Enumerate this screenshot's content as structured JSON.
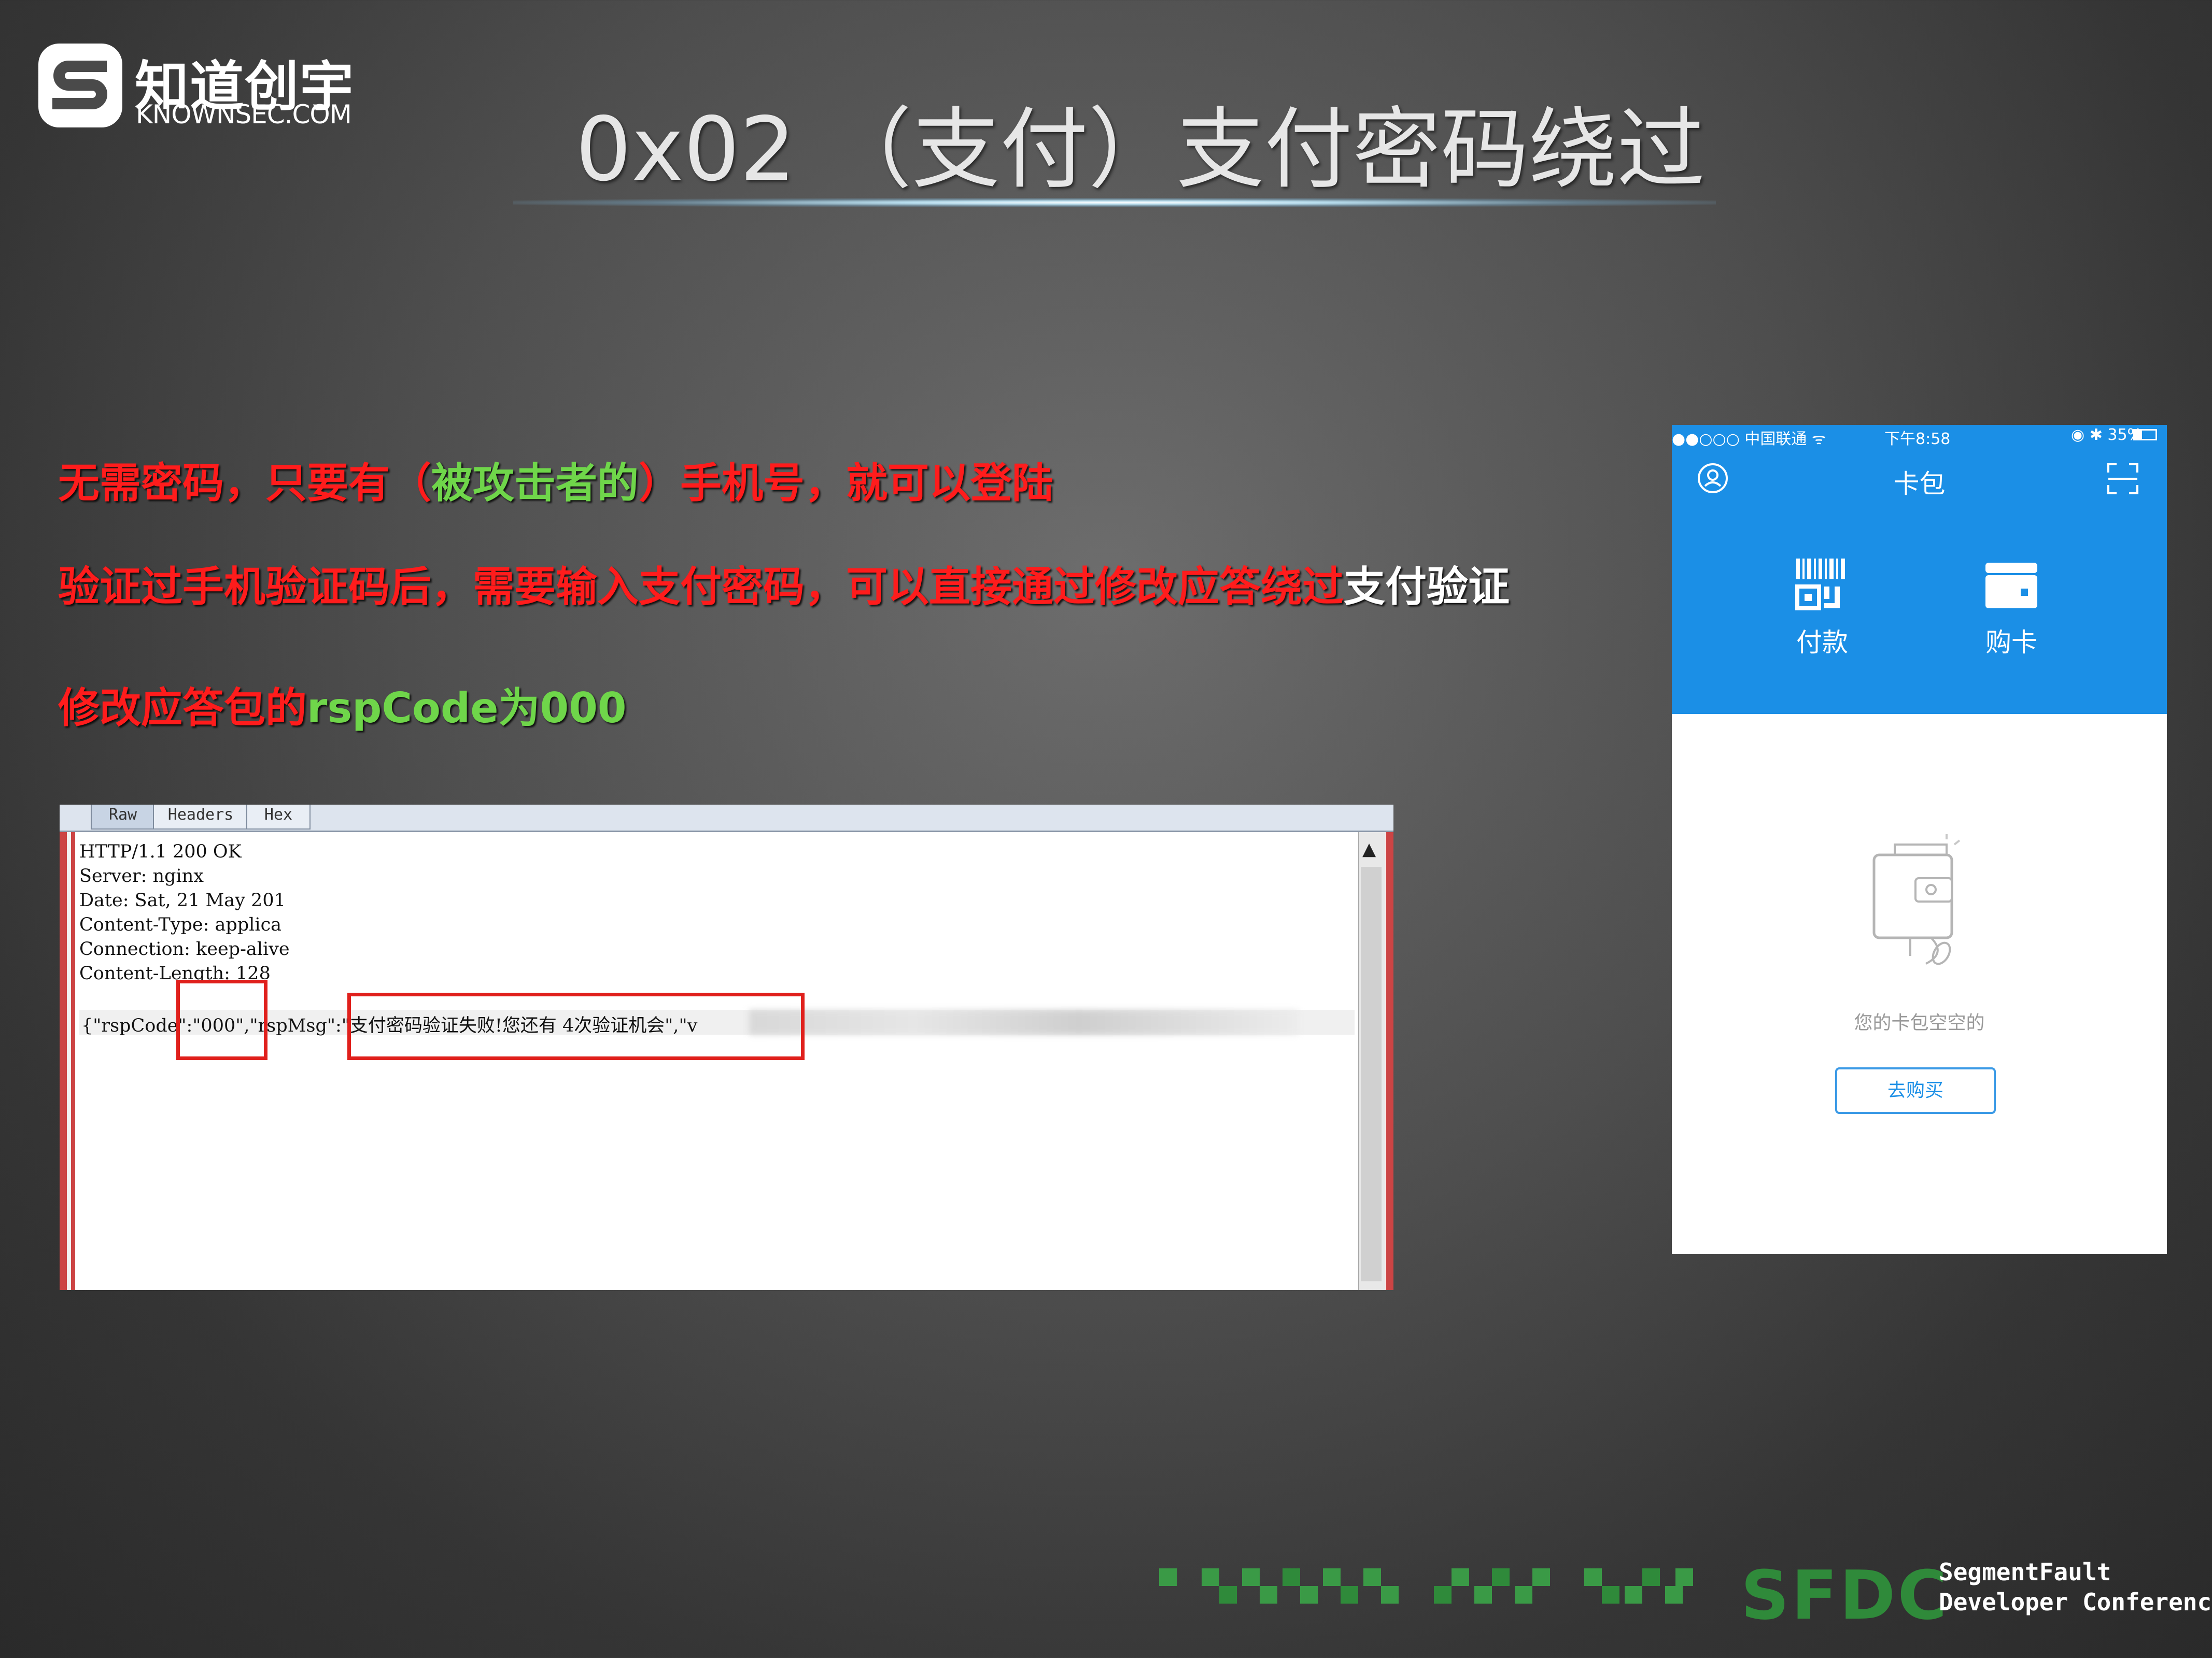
{
  "logo": {
    "cn": "知道创宇",
    "en": "KNOWNSEC.COM"
  },
  "title": "0x02 （支付）支付密码绕过",
  "lines": {
    "line1": {
      "part1": "无需密码，只要有（",
      "part2": "被攻击者的",
      "part3": "）手机号，就可以登陆"
    },
    "line2": {
      "part1": "验证过手机验证码后，需要输入支付密码，可以直接通过修改应答绕过",
      "part2": "支付验证"
    },
    "line3": {
      "part1": "修改应答包的",
      "part2": "rspCode为000"
    }
  },
  "response": {
    "tabs": [
      "Raw",
      "Headers",
      "Hex"
    ],
    "headers": "HTTP/1.1 200 OK\nServer: nginx\nDate: Sat, 21 May 201\nContent-Type: applica\nConnection: keep-alive\nContent-Length: 128",
    "json_line": "{\"rspCode\":\"000\",\"rspMsg\":\"支付密码验证失败!您还有 4次验证机会\",\"v"
  },
  "phone": {
    "status": {
      "carrier": "●●○○○ 中国联通 ᯤ",
      "time": "下午8:58",
      "battery": "◉ ✱ 35%"
    },
    "nav_title": "卡包",
    "actions": {
      "pay": "付款",
      "buy": "购卡"
    },
    "empty_text": "您的卡包空空的",
    "buy_button": "去购买",
    "colors": {
      "header": "#1b8fe6"
    }
  },
  "footer": {
    "logo": "SFDC",
    "sub1": "SegmentFault",
    "sub2": "Developer Conference"
  },
  "colors": {
    "red": "#ff1c1c",
    "green": "#6fd64a",
    "highlight": "#e0201c"
  }
}
